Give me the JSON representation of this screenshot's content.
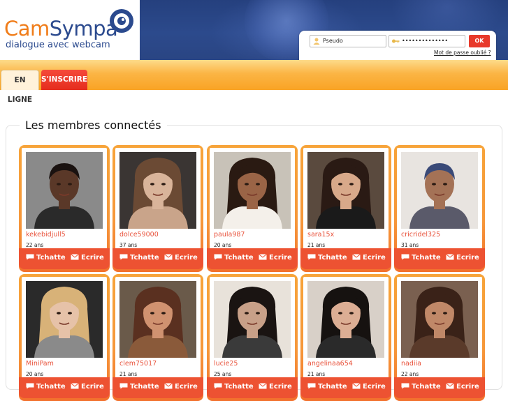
{
  "header": {
    "logo_cam": "Cam",
    "logo_sympa": "Sympa",
    "logo_subtitle": "dialogue avec webcam",
    "login": {
      "pseudo_value": "Pseudo",
      "password_value": "••••••••••••••",
      "ok_label": "OK",
      "forgot_label": "Mot de passe oublié ?"
    }
  },
  "nav": {
    "tabs": [
      {
        "label": "EN LIGNE",
        "active": true
      },
      {
        "label": "S'INSCRIRE",
        "active": false
      }
    ]
  },
  "main": {
    "title": "Les membres connectés",
    "members": [
      {
        "name": "kekebidjull5",
        "age": "22 ans",
        "skin": "#5a3828",
        "hair": "#1a1210",
        "bg": "#8a8a8a",
        "shirt": "#2a2a2a"
      },
      {
        "name": "dolce59000",
        "age": "37 ans",
        "skin": "#d9b49a",
        "hair": "#6b4a34",
        "bg": "#3a3533",
        "shirt": "#c9a48a"
      },
      {
        "name": "paula987",
        "age": "20 ans",
        "skin": "#9a6446",
        "hair": "#2a1a12",
        "bg": "#c8c2b8",
        "shirt": "#f4f0ea"
      },
      {
        "name": "sara15x",
        "age": "21 ans",
        "skin": "#d8a98a",
        "hair": "#2a1a14",
        "bg": "#5a4a3e",
        "shirt": "#1a1a1a"
      },
      {
        "name": "cricridel325",
        "age": "31 ans",
        "skin": "#a47256",
        "hair": "#3a4a78",
        "bg": "#e8e4e0",
        "shirt": "#5a5a6a"
      },
      {
        "name": "MiniPam",
        "age": "20 ans",
        "skin": "#e6c2a8",
        "hair": "#d8b278",
        "bg": "#2a2a2a",
        "shirt": "#8a8a8a"
      },
      {
        "name": "clem75017",
        "age": "21 ans",
        "skin": "#d09270",
        "hair": "#5a3020",
        "bg": "#6a5a4a",
        "shirt": "#8a5a3a"
      },
      {
        "name": "lucie25",
        "age": "25 ans",
        "skin": "#c8a088",
        "hair": "#1a1412",
        "bg": "#e8e2da",
        "shirt": "#3a3a3a"
      },
      {
        "name": "angelinaa654",
        "age": "21 ans",
        "skin": "#dcae94",
        "hair": "#161210",
        "bg": "#d8d0c8",
        "shirt": "#2a2a2a"
      },
      {
        "name": "nadiia",
        "age": "22 ans",
        "skin": "#c08868",
        "hair": "#3a2218",
        "bg": "#7a6050",
        "shirt": "#5a3a2a"
      }
    ],
    "action_chat": "Tchatte",
    "action_write": "Ecrire"
  },
  "colors": {
    "brand_orange": "#f07d1a",
    "brand_blue": "#2b4a8e",
    "action_red": "#ed5232"
  }
}
